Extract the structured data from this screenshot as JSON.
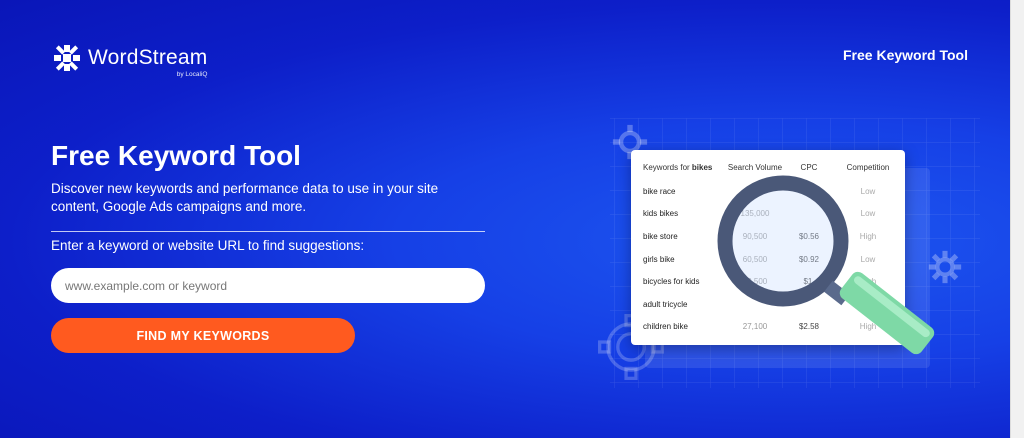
{
  "brand": {
    "name": "WordStream",
    "byline": "by LocaliQ"
  },
  "nav": {
    "top_link": "Free Keyword Tool"
  },
  "hero": {
    "title": "Free Keyword Tool",
    "subtitle": "Discover new keywords and performance data to use in your site content, Google Ads campaigns and more.",
    "prompt": "Enter a keyword or website URL to find suggestions:",
    "search_placeholder": "www.example.com or keyword",
    "search_value": "",
    "cta_label": "FIND MY KEYWORDS"
  },
  "illustration": {
    "header_prefix": "Keywords for ",
    "header_keyword": "bikes",
    "columns": [
      "Search Volume",
      "CPC",
      "Competition"
    ],
    "rows": [
      {
        "keyword": "bike race",
        "volume": "",
        "cpc": "",
        "competition": "Low"
      },
      {
        "keyword": "kids bikes",
        "volume": "135,000",
        "cpc": "",
        "competition": "Low"
      },
      {
        "keyword": "bike store",
        "volume": "90,500",
        "cpc": "$0.56",
        "competition": "High"
      },
      {
        "keyword": "girls bike",
        "volume": "60,500",
        "cpc": "$0.92",
        "competition": "Low"
      },
      {
        "keyword": "bicycles for kids",
        "volume": "49,500",
        "cpc": "$1.",
        "competition": "High"
      },
      {
        "keyword": "adult tricycle",
        "volume": "",
        "cpc": "",
        "competition": ""
      },
      {
        "keyword": "children bike",
        "volume": "27,100",
        "cpc": "$2.58",
        "competition": "High"
      }
    ]
  },
  "colors": {
    "hero_bg": "#0d1fc9",
    "cta_bg": "#ff5a1f",
    "magnifier_rim": "#4a5878",
    "magnifier_handle": "#7ed9a6"
  },
  "icons": [
    "wordstream-logo-icon",
    "gear-icon",
    "magnifier-icon"
  ]
}
